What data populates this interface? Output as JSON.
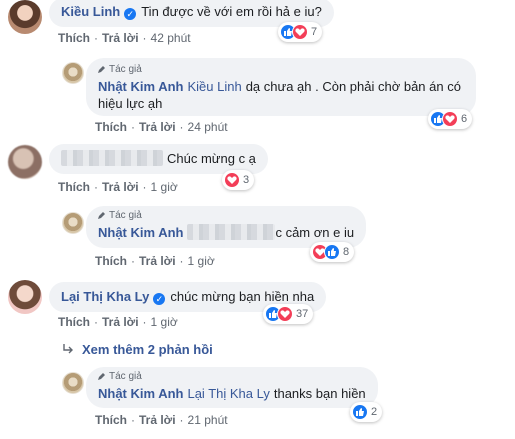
{
  "comments": [
    {
      "author": "Kiều Linh",
      "verified": true,
      "text": "Tin được về với em rồi hả e iu?",
      "actions": {
        "like": "Thích",
        "reply": "Trả lời",
        "time": "42 phút"
      },
      "reaction_count": "7",
      "reactions": [
        "like",
        "heart"
      ]
    },
    {
      "author_tag": "Tác giả",
      "author": "Nhật Kim Anh",
      "mention": "Kiều Linh",
      "text_line1": "dạ chưa ạh . Còn phải chờ bản án có",
      "text_line2": "hiệu lực ạh",
      "actions": {
        "like": "Thích",
        "reply": "Trả lời",
        "time": "24 phút"
      },
      "reaction_count": "6",
      "reactions": [
        "like",
        "heart"
      ]
    },
    {
      "text": "Chúc mừng c ạ",
      "actions": {
        "like": "Thích",
        "reply": "Trả lời",
        "time": "1 giờ"
      },
      "reaction_count": "3",
      "reactions": [
        "heart"
      ]
    },
    {
      "author_tag": "Tác giả",
      "author": "Nhật Kim Anh",
      "text_tail": "c cảm ơn e iu",
      "actions": {
        "like": "Thích",
        "reply": "Trả lời",
        "time": "1 giờ"
      },
      "reaction_count": "8",
      "reactions": [
        "heart",
        "like"
      ]
    },
    {
      "author": "Lại Thị Kha Ly",
      "verified": true,
      "text": "chúc mừng bạn hiền nha",
      "actions": {
        "like": "Thích",
        "reply": "Trả lời",
        "time": "1 giờ"
      },
      "reaction_count": "37",
      "reactions": [
        "like",
        "heart"
      ]
    },
    {
      "author_tag": "Tác giả",
      "author": "Nhật Kim Anh",
      "mention": "Lại Thị Kha Ly",
      "text": "thanks bạn hiền",
      "actions": {
        "like": "Thích",
        "reply": "Trả lời",
        "time": "21 phút"
      },
      "reaction_count": "2",
      "reactions": [
        "like"
      ]
    }
  ],
  "see_more": "Xem thêm 2 phản hồi",
  "colors": {
    "link": "#385898",
    "like": "#1877f2",
    "heart": "#f33e58",
    "bubble": "#f0f2f5",
    "meta": "#606770"
  },
  "icons": {
    "like": "thumbs-up-icon",
    "heart": "heart-icon",
    "verified": "verified-check-icon",
    "author_tag": "pen-icon",
    "see_more": "reply-arrow-icon"
  }
}
